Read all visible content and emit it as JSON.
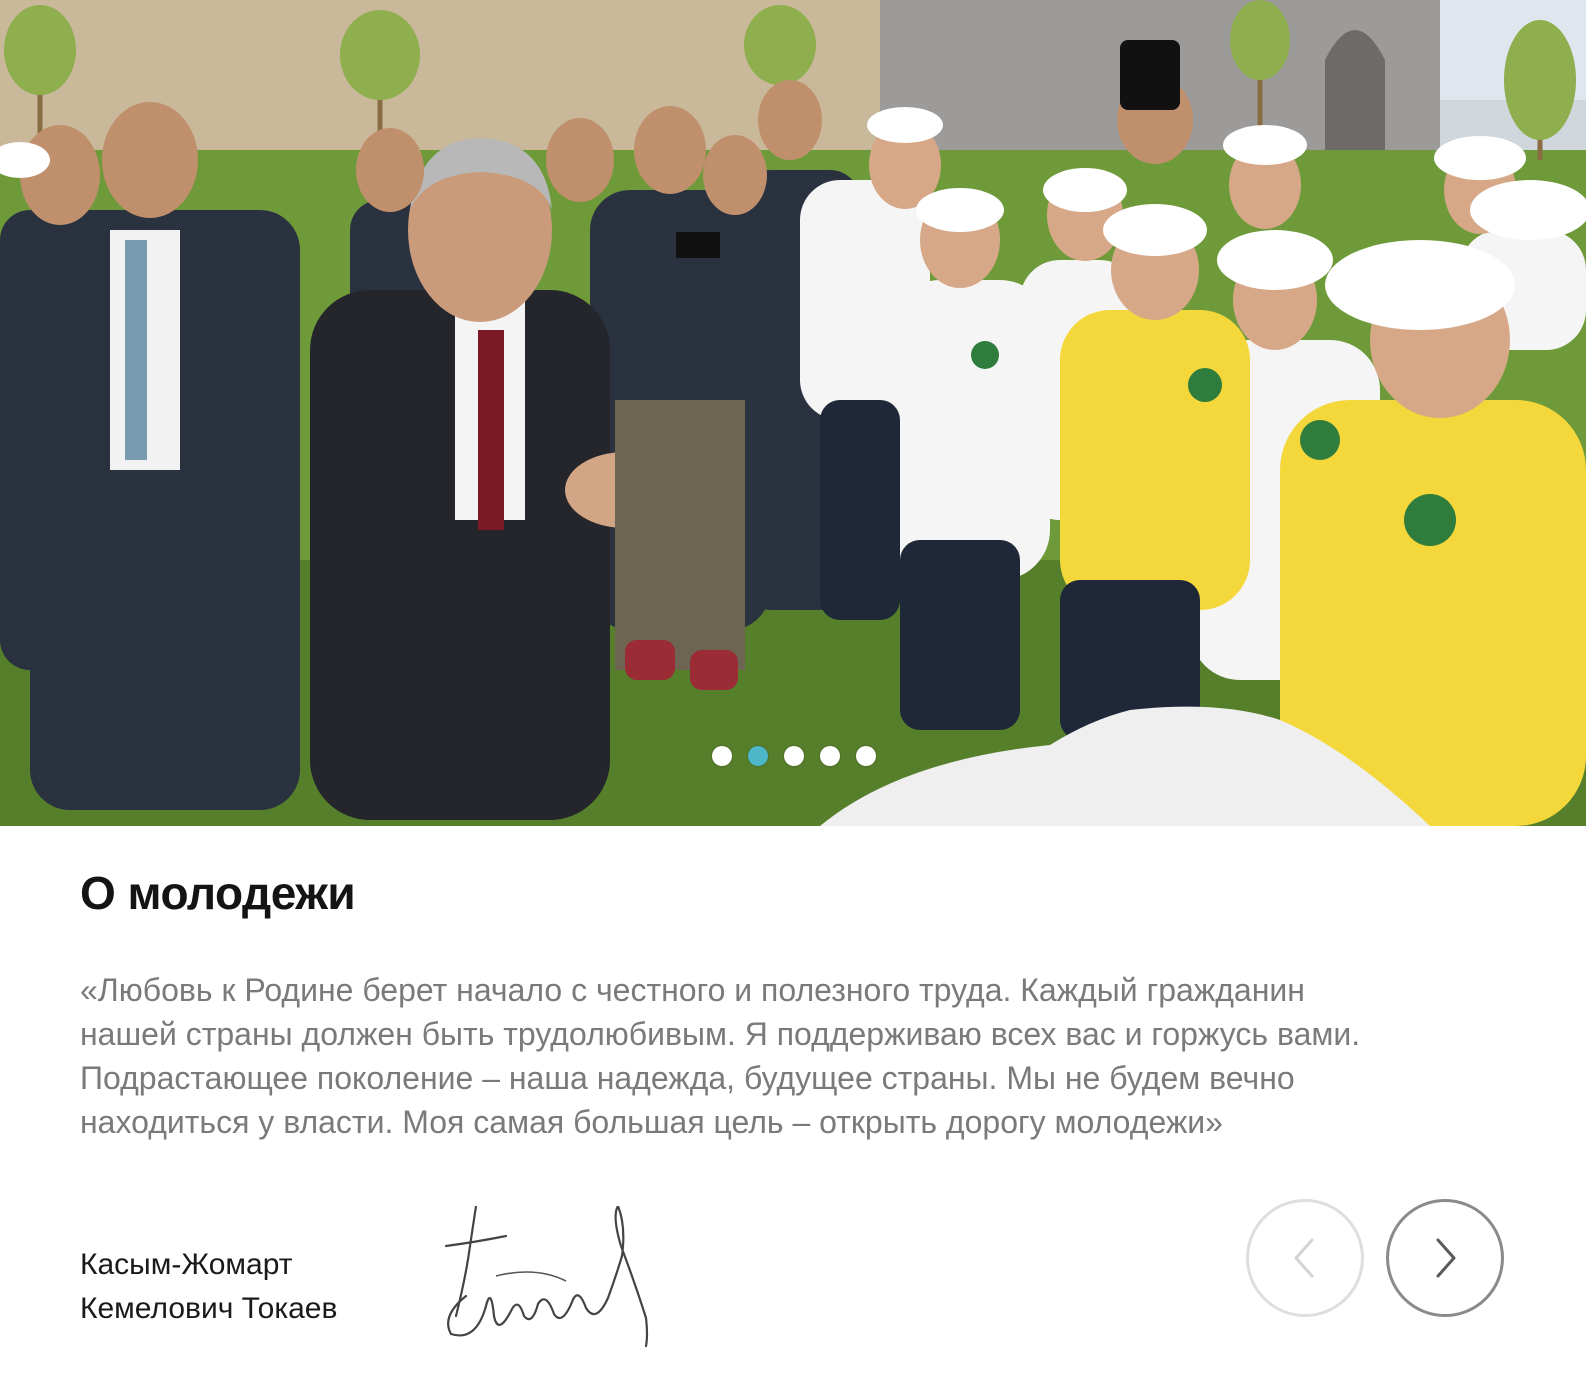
{
  "hero": {
    "slides_count": 5,
    "active_slide": 2
  },
  "section": {
    "title": "О молодежи",
    "quote": "«Любовь к Родине берет начало с честного и полезного труда. Каждый гражданин нашей страны должен быть трудолюбивым. Я поддерживаю всех вас и горжусь вами. Подрастающее поколение – наша надежда, будущее страны. Мы не будем вечно находиться у власти. Моя самая большая цель – открыть дорогу молодежи»",
    "author_line1": "Касым-Жомарт",
    "author_line2": "Кемелович Токаев"
  },
  "navigation": {
    "prev_icon": "chevron-left-icon",
    "next_icon": "chevron-right-icon"
  },
  "colors": {
    "accent_dot": "#4db6c8",
    "title": "#141414",
    "quote_text": "#7a7a7a",
    "prev_border": "#dedede",
    "next_border": "#8a8a8a"
  }
}
